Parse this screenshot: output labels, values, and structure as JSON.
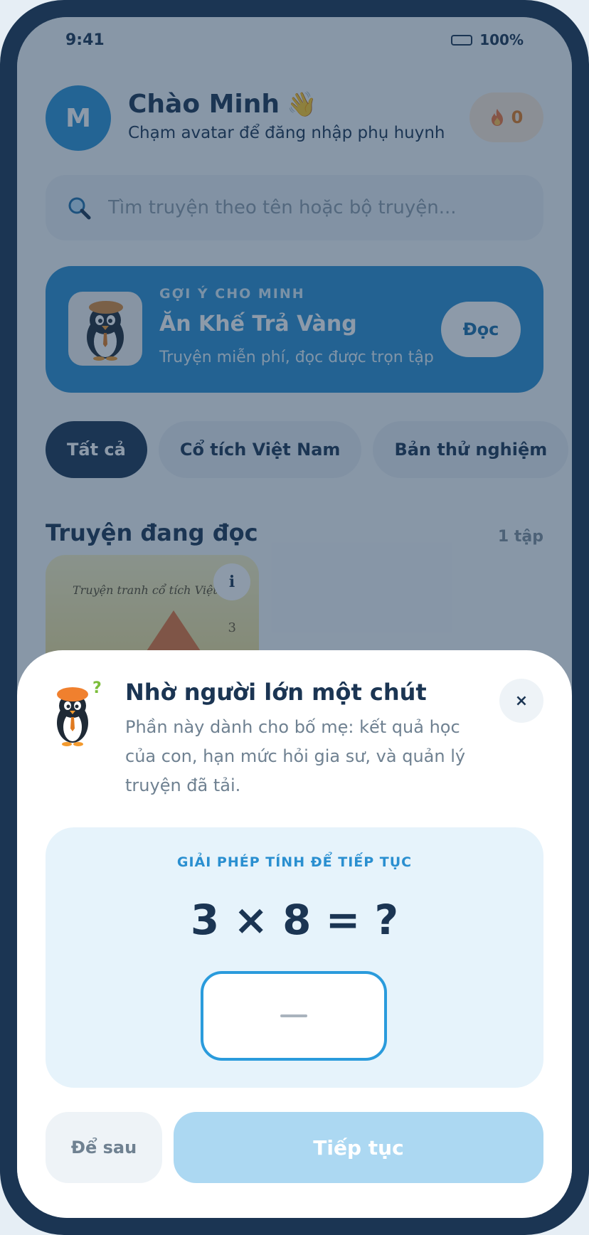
{
  "status": {
    "time": "9:41",
    "battery": "100%"
  },
  "header": {
    "avatar_letter": "M",
    "greeting": "Chào Minh",
    "subtitle": "Chạm avatar để đăng nhập phụ huynh",
    "streak_count": "0"
  },
  "search": {
    "placeholder": "Tìm truyện theo tên hoặc bộ truyện..."
  },
  "featured": {
    "kicker": "GỢI Ý CHO MINH",
    "title": "Ăn Khế Trả Vàng",
    "subtitle": "Truyện miễn phí, đọc được trọn tập",
    "read_label": "Đọc"
  },
  "chips": [
    {
      "label": "Tất cả",
      "active": true
    },
    {
      "label": "Cổ tích Việt Nam",
      "active": false
    },
    {
      "label": "Bản thử nghiệm",
      "active": false
    }
  ],
  "reading": {
    "title": "Truyện đang đọc",
    "count": "1 tập",
    "card": {
      "cover_text": "Truyện tranh cổ tích Việt N",
      "info": "i",
      "badge": "3"
    }
  },
  "sheet": {
    "title": "Nhờ người lớn một chút",
    "description": "Phần này dành cho bố mẹ: kết quả học của con, hạn mức hỏi gia sư, và quản lý truyện đã tải.",
    "close_label": "×",
    "quiz_kicker": "GIẢI PHÉP TÍNH ĐỂ TIẾP TỤC",
    "equation": "3 × 8 = ?",
    "answer_value": "",
    "later_label": "Để sau",
    "continue_label": "Tiếp tục"
  },
  "colors": {
    "navy": "#1b3553",
    "primary_blue": "#2a8fd0",
    "overlay": "rgba(27,53,83,0.50)",
    "continue_disabled": "#acd8f2"
  }
}
